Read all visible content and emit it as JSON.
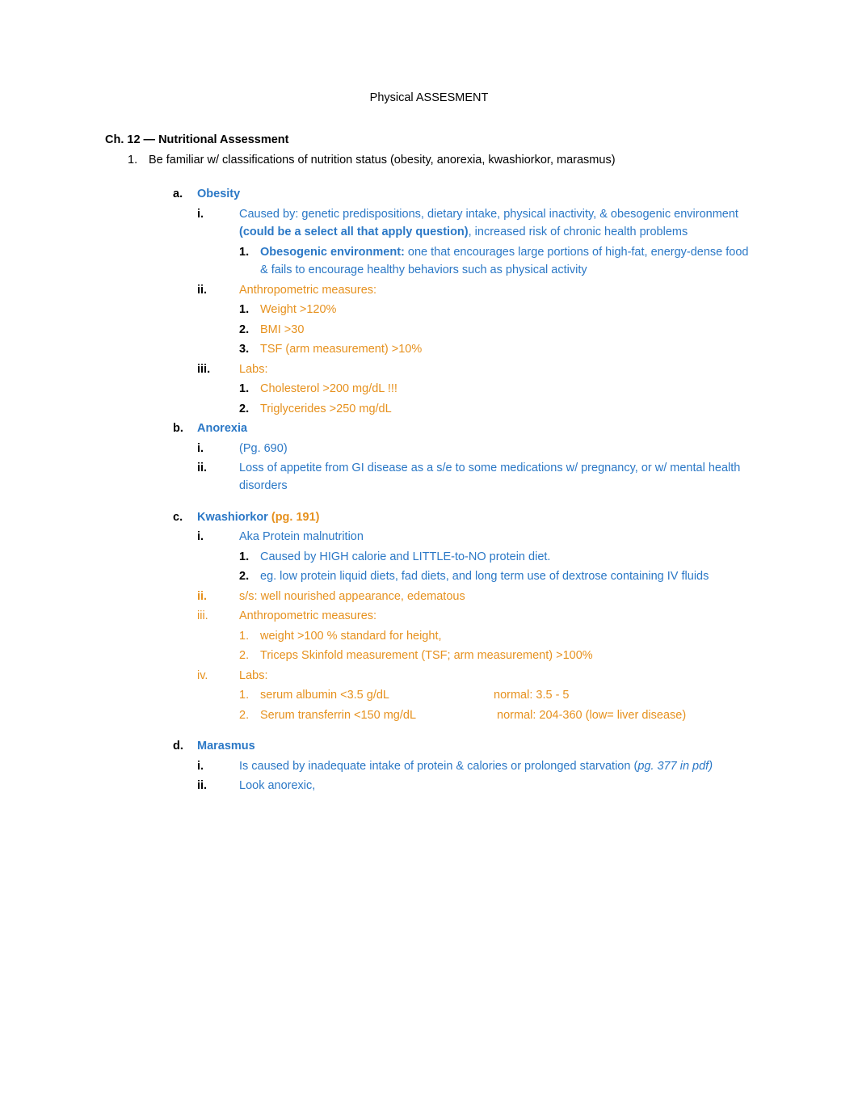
{
  "title": "Physical ASSESMENT",
  "chapter": "Ch. 12 — Nutritional Assessment",
  "item1": {
    "num": "1.",
    "text": "Be familiar w/ classifications of nutrition status (obesity, anorexia, kwashiorkor, marasmus)"
  },
  "obesity": {
    "marker": "a.",
    "heading": "Obesity",
    "i_m": "i.",
    "i_p1": "Caused by:  genetic predispositions, dietary intake, physical inactivity, & obesogenic environment ",
    "i_bold": "(could be a select all that apply question)",
    "i_p2": ", increased risk of chronic health problems",
    "i_1_m": "1.",
    "i_1_bold": "Obesogenic environment:",
    "i_1_rest": " one that encourages large portions of high-fat, energy-dense food & fails to encourage healthy behaviors such as physical activity",
    "ii_m": "ii.",
    "ii_t": "Anthropometric measures:",
    "ii_1_m": "1.",
    "ii_1_t": "Weight >120%",
    "ii_2_m": "2.",
    "ii_2_t": "BMI >30",
    "ii_3_m": "3.",
    "ii_3_t": "TSF (arm measurement) >10%",
    "iii_m": "iii.",
    "iii_t": "Labs:",
    "iii_1_m": "1.",
    "iii_1_t": "Cholesterol >200 mg/dL !!!",
    "iii_2_m": "2.",
    "iii_2_t": "Triglycerides >250 mg/dL"
  },
  "anorexia": {
    "marker": "b.",
    "heading": "Anorexia",
    "i_m": "i.",
    "i_t": "(Pg. 690)",
    "ii_m": "ii.",
    "ii_t": "Loss of appetite from GI disease as a s/e to some medications w/ pregnancy, or w/ mental health disorders"
  },
  "kwashiorkor": {
    "marker": "c.",
    "heading": "Kwashiorkor",
    "pg": " (pg. 191)",
    "i_m": "i.",
    "i_t": "Aka Protein malnutrition",
    "i_1_m": "1.",
    "i_1_t": "Caused by HIGH calorie and LITTLE-to-NO protein diet.",
    "i_2_m": "2.",
    "i_2_t": "eg. low protein liquid diets, fad diets, and long term use of dextrose containing IV fluids",
    "ii_m": "ii.",
    "ii_t": "s/s: well nourished appearance, edematous",
    "iii_m": "iii.",
    "iii_t": "Anthropometric measures:",
    "iii_1_m": "1.",
    "iii_1_t": "weight >100 % standard for height,",
    "iii_2_m": "2.",
    "iii_2_t": "Triceps Skinfold measurement (TSF; arm measurement) >100%",
    "iv_m": "iv.",
    "iv_t": "Labs:",
    "iv_1_m": "1.",
    "iv_1_a": "serum albumin <3.5 g/dL",
    "iv_1_b": "normal:  3.5 - 5",
    "iv_2_m": "2.",
    "iv_2_a": "Serum transferrin <150 mg/dL",
    "iv_2_b": " normal: 204-360 (low= liver disease)"
  },
  "marasmus": {
    "marker": "d.",
    "heading": "Marasmus",
    "i_m": "i.",
    "i_p1": "Is caused by inadequate intake of protein & calories or prolonged starvation (",
    "i_p2": "pg. 377 in pdf)",
    "ii_m": "ii.",
    "ii_t": "Look anorexic,"
  }
}
